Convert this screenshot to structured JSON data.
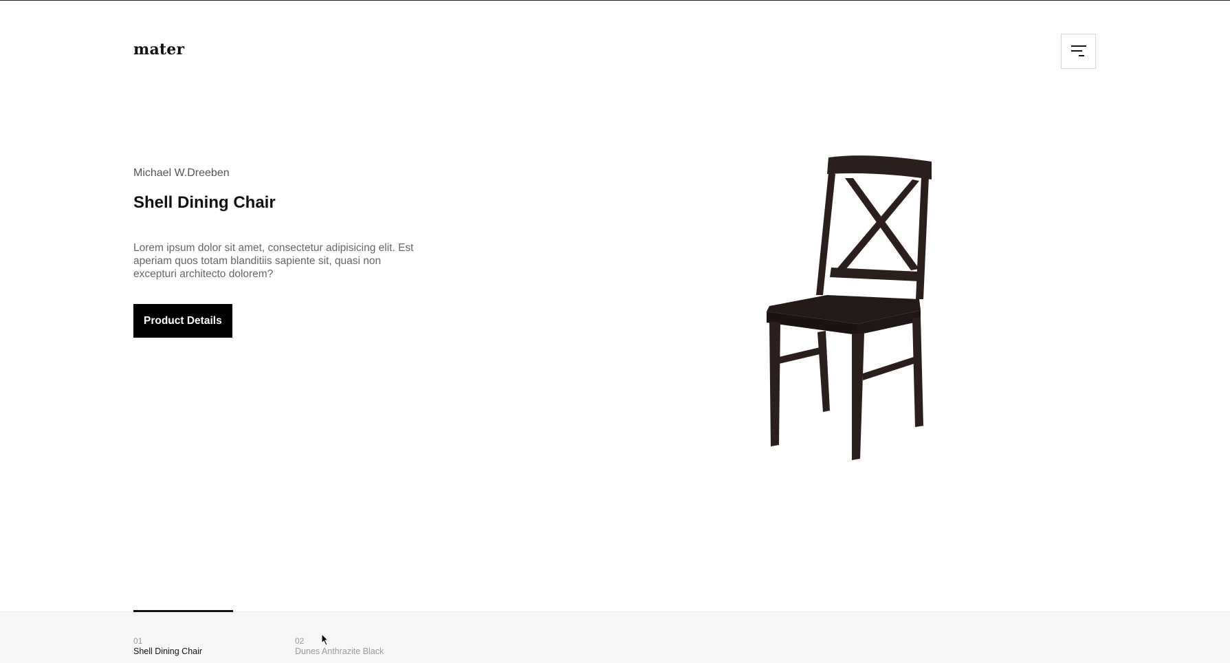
{
  "brand": {
    "logo_text": "mater"
  },
  "header": {
    "menu_icon": "menu-icon"
  },
  "hero": {
    "designer": "Michael W.Dreeben",
    "title": "Shell Dining Chair",
    "description": "Lorem ipsum dolor sit amet, consectetur adipisicing elit. Est aperiam quos totam blanditiis sapiente sit, quasi non excepturi architecto dolorem?",
    "cta_label": "Product Details"
  },
  "slider": {
    "progress": 0.5,
    "slides": [
      {
        "number": "01",
        "name": "Shell Dining Chair",
        "active": true
      },
      {
        "number": "02",
        "name": "Dunes Anthrazite Black",
        "active": false
      }
    ]
  },
  "colors": {
    "accent": "#000000",
    "text_muted": "#666666",
    "background": "#ffffff",
    "footer_bg": "#f7f7f7",
    "chair": "#2a1f1d"
  }
}
